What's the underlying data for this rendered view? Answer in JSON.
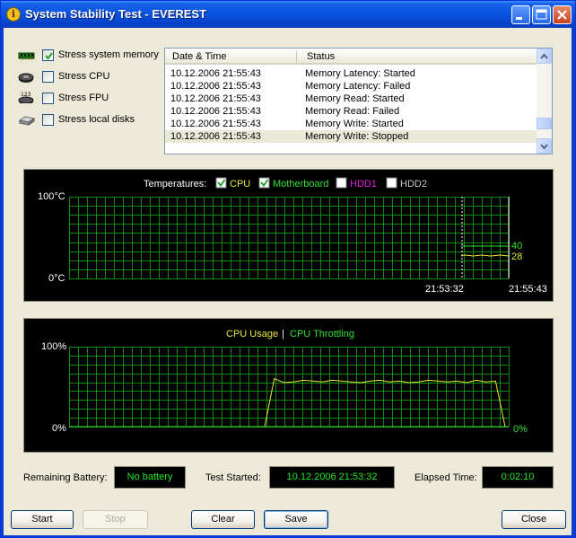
{
  "window": {
    "title": "System Stability Test - EVEREST",
    "app_icon": "info-icon",
    "controls": [
      "minimize-icon",
      "maximize-icon",
      "close-icon"
    ]
  },
  "options": [
    {
      "label": "Stress system memory",
      "checked": true,
      "icon": "memory-icon"
    },
    {
      "label": "Stress CPU",
      "checked": false,
      "icon": "cpu-icon"
    },
    {
      "label": "Stress FPU",
      "checked": false,
      "icon": "fpu-icon",
      "icon_text": "123"
    },
    {
      "label": "Stress local disks",
      "checked": false,
      "icon": "disk-icon"
    }
  ],
  "log": {
    "columns": [
      "Date & Time",
      "Status"
    ],
    "rows": [
      {
        "time": "10.12.2006 21:55:43",
        "status": "Memory Latency: Started"
      },
      {
        "time": "10.12.2006 21:55:43",
        "status": "Memory Latency: Failed"
      },
      {
        "time": "10.12.2006 21:55:43",
        "status": "Memory Read: Started"
      },
      {
        "time": "10.12.2006 21:55:43",
        "status": "Memory Read: Failed"
      },
      {
        "time": "10.12.2006 21:55:43",
        "status": "Memory Write: Started"
      },
      {
        "time": "10.12.2006 21:55:43",
        "status": "Memory Write: Stopped"
      }
    ],
    "selected_row": 5
  },
  "temperature_chart": {
    "legend_title": "Temperatures:",
    "sensors": [
      {
        "label": "CPU",
        "checked": true,
        "color": "#e8e83a"
      },
      {
        "label": "Motherboard",
        "checked": true,
        "color": "#36e036"
      },
      {
        "label": "HDD1",
        "checked": false,
        "color": "#e020e0"
      },
      {
        "label": "HDD2",
        "checked": false,
        "color": "#c8c8c8"
      }
    ],
    "y_max_label": "100°C",
    "y_min_label": "0°C",
    "x_labels": [
      "21:53:32",
      "21:55:43"
    ],
    "current_values": {
      "motherboard": "40",
      "cpu": "28"
    },
    "colors": {
      "grid": "#0f8a0f",
      "background": "#000000"
    }
  },
  "cpu_chart": {
    "title_usage": "CPU Usage",
    "separator": "|",
    "title_throttling": "CPU Throttling",
    "y_max_label": "100%",
    "y_min_label": "0%",
    "throttling_value": "0%",
    "colors": {
      "usage": "#e8e83a",
      "throttling": "#36e036",
      "grid": "#0f8a0f"
    }
  },
  "chart_data": [
    {
      "type": "line",
      "title": "Temperatures",
      "ylabel": "°C",
      "ylim": [
        0,
        100
      ],
      "x": [
        "21:53:32",
        "21:55:43"
      ],
      "series": [
        {
          "name": "CPU",
          "values": [
            28,
            28
          ]
        },
        {
          "name": "Motherboard",
          "values": [
            40,
            40
          ]
        }
      ],
      "grid": true
    },
    {
      "type": "line",
      "title": "CPU Usage",
      "ylabel": "%",
      "ylim": [
        0,
        100
      ],
      "series": [
        {
          "name": "CPU Usage",
          "values": [
            0,
            60,
            55,
            56,
            58,
            57,
            56,
            58,
            57,
            56,
            55,
            57,
            58,
            56,
            57,
            55,
            56,
            58,
            57,
            56,
            57,
            55,
            58,
            56,
            57,
            0
          ]
        },
        {
          "name": "CPU Throttling",
          "values": [
            0
          ]
        }
      ],
      "grid": true
    }
  ],
  "status": {
    "battery_label": "Remaining Battery:",
    "battery_value": "No battery",
    "started_label": "Test Started:",
    "started_value": "10.12.2006 21:53:32",
    "elapsed_label": "Elapsed Time:",
    "elapsed_value": "0:02:10"
  },
  "buttons": {
    "start": "Start",
    "stop": "Stop",
    "clear": "Clear",
    "save": "Save",
    "close": "Close"
  }
}
